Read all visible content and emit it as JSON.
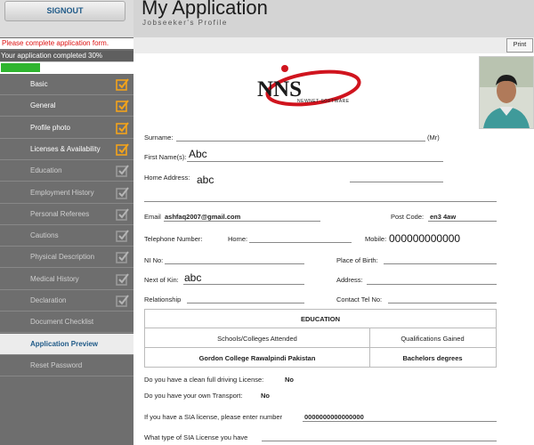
{
  "left": {
    "signout_label": "SIGNOUT",
    "complete_message": "Please complete application form.",
    "progress_text": "Your application completed 30%",
    "progress_fraction": 0.3,
    "nav": [
      {
        "label": "Basic",
        "state": "done",
        "check": "checked-orange"
      },
      {
        "label": "General",
        "state": "done",
        "check": "checked-orange"
      },
      {
        "label": "Profile photo",
        "state": "done",
        "check": "checked-orange"
      },
      {
        "label": "Licenses & Availability",
        "state": "done",
        "check": "checked-orange"
      },
      {
        "label": "Education",
        "state": "todo",
        "check": "unchecked-grey"
      },
      {
        "label": "Employment History",
        "state": "todo",
        "check": "unchecked-grey"
      },
      {
        "label": "Personal Referees",
        "state": "todo",
        "check": "unchecked-grey"
      },
      {
        "label": "Cautions",
        "state": "todo",
        "check": "unchecked-grey"
      },
      {
        "label": "Physical Description",
        "state": "todo",
        "check": "unchecked-grey"
      },
      {
        "label": "Medical History",
        "state": "todo",
        "check": "unchecked-grey"
      },
      {
        "label": "Declaration",
        "state": "todo",
        "check": "unchecked-grey"
      },
      {
        "label": "Document Checklist",
        "state": "todo",
        "check": "none"
      },
      {
        "label": "Application Preview",
        "state": "active",
        "check": "none"
      },
      {
        "label": "Reset Password",
        "state": "todo",
        "check": "none"
      }
    ]
  },
  "header": {
    "title": "My Application",
    "subtitle": "Jobseeker's Profile",
    "print_label": "Print"
  },
  "logo": {
    "text": "NNS",
    "tagline": "NEWNET SOFTWARE"
  },
  "form": {
    "surname_label": "Surname:",
    "surname_suffix": "(Mr)",
    "first_name_label": "First Name(s):",
    "first_name_value": "Abc",
    "home_address_label": "Home Address:",
    "home_address_value": "abc",
    "email_label": "Email",
    "email_value": "ashfaq2007@gmail.com",
    "post_code_label": "Post Code:",
    "post_code_value": "en3 4aw",
    "telephone_label": "Telephone Number:",
    "home_label": "Home:",
    "mobile_label": "Mobile:",
    "mobile_value": "000000000000",
    "ni_label": "NI No:",
    "place_of_birth_label": "Place of Birth:",
    "next_of_kin_label": "Next of Kin:",
    "next_of_kin_value": "abc",
    "address_label": "Address:",
    "relationship_label": "Relationship",
    "contact_tel_label": "Contact Tel No:"
  },
  "education": {
    "heading": "EDUCATION",
    "col_school": "Schools/Colleges Attended",
    "col_qual": "Qualifications Gained",
    "school_value": "Gordon College Rawalpindi Pakistan",
    "qual_value": "Bachelors degrees"
  },
  "questions": {
    "driving_q": "Do you have a clean full driving License:",
    "driving_a": "No",
    "transport_q": "Do you have your own Transport:",
    "transport_a": "No",
    "sia_q": "If you have a SIA license, please enter number",
    "sia_a": "0000000000000000",
    "sia_type_q": "What type of SIA License you have"
  },
  "colors": {
    "sidebar_bg": "#6e6e6e",
    "progress_green": "#2fb52f",
    "check_orange": "#f2a31b",
    "logo_red": "#d0141e",
    "error_red": "#d11111",
    "link_blue": "#1f5a88"
  }
}
